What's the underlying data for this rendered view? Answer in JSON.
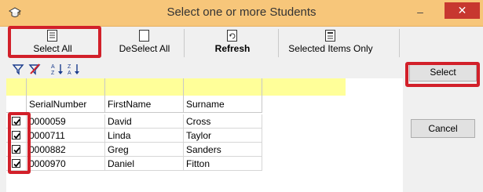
{
  "window": {
    "title": "Select one or more Students",
    "minimize_glyph": "–",
    "close_glyph": "✕"
  },
  "toolbar": {
    "select_all": "Select All",
    "deselect_all": "DeSelect All",
    "refresh": "Refresh",
    "selected_only": "Selected Items Only"
  },
  "actions": {
    "select": "Select",
    "cancel": "Cancel"
  },
  "grid": {
    "columns": [
      "SerialNumber",
      "FirstName",
      "Surname"
    ],
    "rows": [
      {
        "serial": "0000059",
        "first": "David",
        "last": "Cross",
        "checked": true
      },
      {
        "serial": "0000711",
        "first": "Linda",
        "last": "Taylor",
        "checked": true
      },
      {
        "serial": "0000882",
        "first": "Greg",
        "last": "Sanders",
        "checked": true
      },
      {
        "serial": "0000970",
        "first": "Daniel",
        "last": "Fitton",
        "checked": true
      }
    ]
  },
  "icons": [
    "app-icon",
    "page-icon",
    "blank-page-icon",
    "refresh-page-icon",
    "list-page-icon",
    "filter-icon",
    "clear-filter-icon",
    "sort-ascending-icon",
    "sort-descending-icon",
    "checkbox-checked-icon"
  ],
  "colors": {
    "titlebar": "#f7c67a",
    "filter_row": "#ffff99",
    "highlight": "#d2202a",
    "close": "#c7372f"
  }
}
